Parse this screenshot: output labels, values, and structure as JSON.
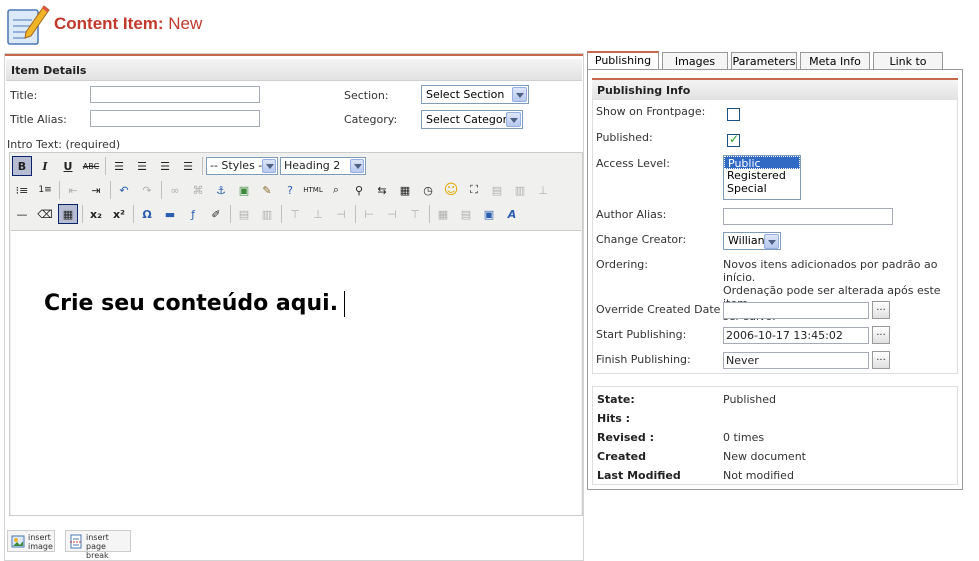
{
  "header": {
    "title": "Content Item:",
    "subtitle": "New"
  },
  "item_details": {
    "heading": "Item Details",
    "title_label": "Title:",
    "title_alias_label": "Title Alias:",
    "section_label": "Section:",
    "section_value": "Select Section",
    "category_label": "Category:",
    "category_value": "Select Category",
    "intro_label": "Intro Text: (required)"
  },
  "editor": {
    "styles_value": "-- Styles --",
    "format_value": "Heading 2",
    "content": "Crie seu conteúdo aqui.",
    "insert_image": [
      "insert",
      "image"
    ],
    "insert_pagebreak": [
      "insert",
      "page break"
    ]
  },
  "tabs": [
    "Publishing",
    "Images",
    "Parameters",
    "Meta Info",
    "Link to Menu"
  ],
  "publishing": {
    "heading": "Publishing Info",
    "frontpage_label": "Show on Frontpage:",
    "published_label": "Published:",
    "access_label": "Access Level:",
    "access_options": [
      "Public",
      "Registered",
      "Special"
    ],
    "author_alias_label": "Author Alias:",
    "change_creator_label": "Change Creator:",
    "change_creator_value": "Willian",
    "ordering_label": "Ordering:",
    "ordering_text": [
      "Novos itens adicionados por padrão ao início.",
      "Ordenação pode ser alterada após este item",
      "ser salvo."
    ],
    "override_label": "Override Created Date",
    "start_label": "Start Publishing:",
    "start_value": "2006-10-17 13:45:02",
    "finish_label": "Finish Publishing:",
    "finish_value": "Never",
    "date_button": "..."
  },
  "info": {
    "state_label": "State:",
    "state_value": "Published",
    "hits_label": "Hits :",
    "hits_value": "",
    "revised_label": "Revised :",
    "revised_value": "0 times",
    "created_label": "Created",
    "created_value": "New document",
    "modified_label": "Last Modified",
    "modified_value": "Not modified"
  },
  "colors": {
    "accent": "#c0392b",
    "tab_line": "#c9694c",
    "select_blue": "#316ac5"
  }
}
